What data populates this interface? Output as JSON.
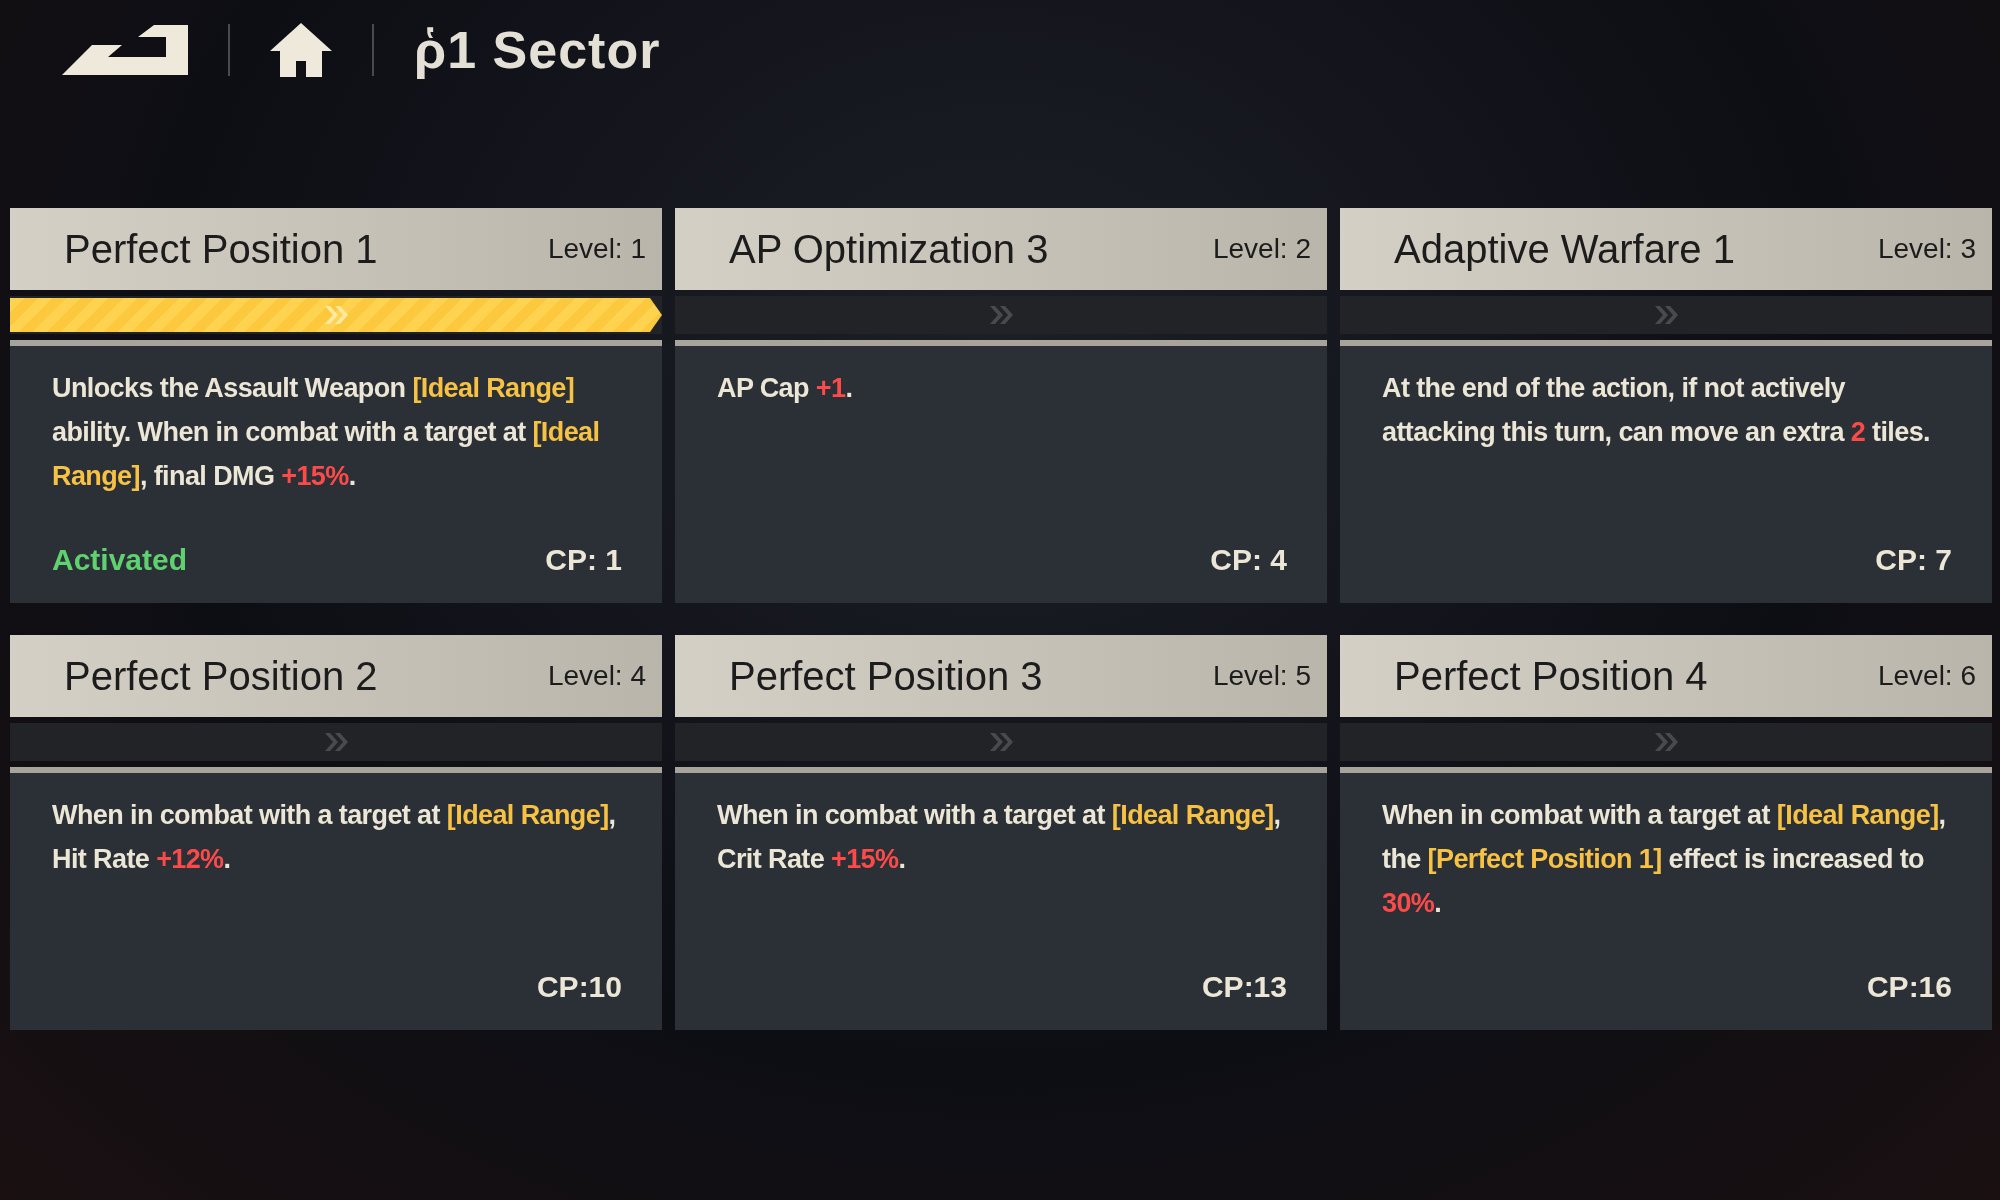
{
  "nav": {
    "title": "ῥ1 Sector"
  },
  "cards": [
    {
      "title": "Perfect Position 1",
      "level_label": "Level: 1",
      "progress": {
        "level": 1
      },
      "description": [
        {
          "text": "Unlocks the Assault Weapon ",
          "kind": "plain"
        },
        {
          "text": "[Ideal Range]",
          "kind": "keyword"
        },
        {
          "text": " ability. When in combat with a target at ",
          "kind": "plain"
        },
        {
          "text": "[Ideal Range]",
          "kind": "keyword"
        },
        {
          "text": ", final DMG ",
          "kind": "plain"
        },
        {
          "text": "+15%",
          "kind": "bonus"
        },
        {
          "text": ".",
          "kind": "plain"
        }
      ],
      "status": "Activated",
      "cost": "CP: 1"
    },
    {
      "title": "AP Optimization 3",
      "level_label": "Level: 2",
      "description": [
        {
          "text": "AP Cap ",
          "kind": "plain"
        },
        {
          "text": "+1",
          "kind": "bonus"
        },
        {
          "text": ".",
          "kind": "plain"
        }
      ],
      "cost": "CP: 4"
    },
    {
      "title": "Adaptive Warfare 1",
      "level_label": "Level: 3",
      "description": [
        {
          "text": "At the end of the action, if not actively attacking this turn, can move an extra ",
          "kind": "plain"
        },
        {
          "text": "2",
          "kind": "bonus"
        },
        {
          "text": " tiles.",
          "kind": "plain"
        }
      ],
      "cost": "CP: 7"
    },
    {
      "title": "Perfect Position 2",
      "level_label": "Level: 4",
      "description": [
        {
          "text": "When in combat with a target at ",
          "kind": "plain"
        },
        {
          "text": "[Ideal Range]",
          "kind": "keyword"
        },
        {
          "text": ", Hit Rate ",
          "kind": "plain"
        },
        {
          "text": "+12%",
          "kind": "bonus"
        },
        {
          "text": ".",
          "kind": "plain"
        }
      ],
      "cost": "CP:10"
    },
    {
      "title": "Perfect Position 3",
      "level_label": "Level: 5",
      "description": [
        {
          "text": "When in combat with a target at ",
          "kind": "plain"
        },
        {
          "text": "[Ideal Range]",
          "kind": "keyword"
        },
        {
          "text": ", Crit Rate ",
          "kind": "plain"
        },
        {
          "text": "+15%",
          "kind": "bonus"
        },
        {
          "text": ".",
          "kind": "plain"
        }
      ],
      "cost": "CP:13"
    },
    {
      "title": "Perfect Position 4",
      "level_label": "Level: 6",
      "description": [
        {
          "text": "When in combat with a target at ",
          "kind": "plain"
        },
        {
          "text": "[Ideal Range]",
          "kind": "keyword"
        },
        {
          "text": ", the ",
          "kind": "plain"
        },
        {
          "text": "[Perfect Position 1]",
          "kind": "keyword"
        },
        {
          "text": " effect is increased to ",
          "kind": "plain"
        },
        {
          "text": "30%",
          "kind": "bonus"
        },
        {
          "text": ".",
          "kind": "plain"
        }
      ],
      "cost": "CP:16"
    }
  ]
}
